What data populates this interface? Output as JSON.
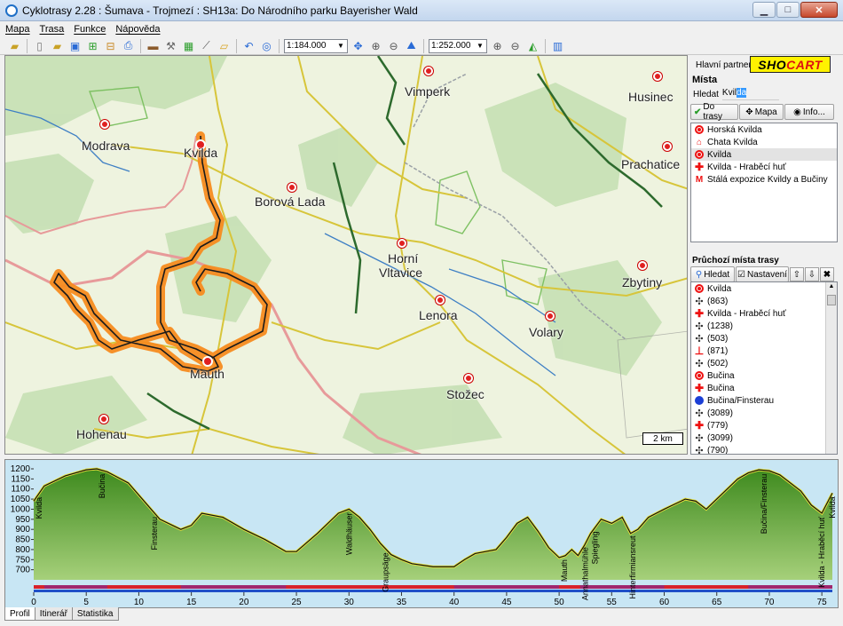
{
  "window": {
    "title": "Cyklotrasy 2.28 : Šumava - Trojmezí : SH13a: Do Národního parku Bayerisher Wald"
  },
  "menu": [
    "Mapa",
    "Trasa",
    "Funkce",
    "Nápověda"
  ],
  "toolbar": {
    "scale1": "1:184.000",
    "scale2": "1:252.000"
  },
  "map": {
    "towns": [
      {
        "name": "Vimperk"
      },
      {
        "name": "Husinec"
      },
      {
        "name": "Modrava"
      },
      {
        "name": "Kvilda"
      },
      {
        "name": "Prachatice"
      },
      {
        "name": "Borová Lada"
      },
      {
        "name": "Horní"
      },
      {
        "name": "Vltavice"
      },
      {
        "name": "Lenora"
      },
      {
        "name": "Zbytiny"
      },
      {
        "name": "Volary"
      },
      {
        "name": "Mauth"
      },
      {
        "name": "Stožec"
      },
      {
        "name": "Hohenau"
      }
    ],
    "scale_label": "2 km"
  },
  "panel": {
    "partner_label": "Hlavní partner",
    "logo_text_a": "SHO",
    "logo_text_b": "CART",
    "places_title": "Místa",
    "search_label": "Hledat",
    "search_value_a": "Kvil",
    "search_value_b": "da",
    "btn_route": "Do trasy",
    "btn_map": "Mapa",
    "btn_info": "Info...",
    "places": [
      {
        "icon": "circle",
        "label": "Horská Kvilda"
      },
      {
        "icon": "house",
        "label": "Chata Kvilda"
      },
      {
        "icon": "circle",
        "label": "Kvilda"
      },
      {
        "icon": "cross",
        "label": "Kvilda - Hraběcí huť"
      },
      {
        "icon": "m",
        "label": "Stálá expozice Kvildy a Bučiny"
      }
    ],
    "trace_title": "Průchozí místa trasy",
    "trace_search": "Hledat",
    "trace_settings": "Nastavení",
    "trace": [
      {
        "icon": "circle",
        "label": "Kvilda"
      },
      {
        "icon": "star",
        "label": "(863)"
      },
      {
        "icon": "cross",
        "label": "Kvilda - Hraběcí huť"
      },
      {
        "icon": "star",
        "label": "(1238)"
      },
      {
        "icon": "star",
        "label": "(503)"
      },
      {
        "icon": "tee",
        "label": "(871)"
      },
      {
        "icon": "star",
        "label": "(502)"
      },
      {
        "icon": "circle",
        "label": "Bučina"
      },
      {
        "icon": "cross",
        "label": "Bučina"
      },
      {
        "icon": "blue",
        "label": "Bučina/Finsterau"
      },
      {
        "icon": "star",
        "label": "(3089)"
      },
      {
        "icon": "cross",
        "label": "(779)"
      },
      {
        "icon": "star",
        "label": "(3099)"
      },
      {
        "icon": "star",
        "label": "(790)"
      }
    ]
  },
  "chart_data": {
    "type": "area",
    "xlabel": "",
    "ylabel": "",
    "xlim": [
      0,
      76
    ],
    "ylim": [
      650,
      1200
    ],
    "x_ticks": [
      0,
      5,
      10,
      15,
      20,
      25,
      30,
      35,
      40,
      45,
      50,
      55,
      60,
      65,
      70,
      75
    ],
    "y_ticks": [
      700,
      750,
      800,
      850,
      900,
      950,
      1000,
      1050,
      1100,
      1150,
      1200
    ],
    "x": [
      0,
      1,
      3,
      5,
      6,
      7,
      9,
      11,
      12,
      14,
      15,
      16,
      18,
      20,
      22,
      24,
      25,
      27,
      29,
      30,
      31,
      32,
      33,
      34,
      35,
      36,
      38,
      40,
      41,
      42,
      44,
      45,
      46,
      47,
      48,
      49,
      50,
      50.6,
      51.2,
      51.8,
      52.4,
      53,
      54,
      55,
      56,
      56.8,
      57.5,
      58.5,
      60,
      62,
      63,
      64,
      65,
      67,
      68,
      69,
      70,
      71,
      73,
      74,
      75,
      76
    ],
    "values": [
      1040,
      1115,
      1165,
      1195,
      1200,
      1185,
      1130,
      1010,
      950,
      900,
      920,
      980,
      960,
      900,
      850,
      790,
      790,
      880,
      980,
      1000,
      960,
      900,
      830,
      775,
      750,
      730,
      715,
      715,
      750,
      780,
      800,
      860,
      930,
      960,
      890,
      810,
      760,
      770,
      800,
      770,
      820,
      880,
      950,
      930,
      960,
      880,
      900,
      960,
      1000,
      1050,
      1040,
      1000,
      1050,
      1150,
      1180,
      1195,
      1190,
      1170,
      1090,
      1020,
      980,
      1080
    ],
    "annotations": [
      {
        "x": 0.5,
        "label": "Kvilda"
      },
      {
        "x": 6.5,
        "label": "Bučina"
      },
      {
        "x": 11.5,
        "label": "Finsterau"
      },
      {
        "x": 30,
        "label": "Waldhäuser"
      },
      {
        "x": 33.5,
        "label": "Graupsäge"
      },
      {
        "x": 50.5,
        "label": "Mauth"
      },
      {
        "x": 52.5,
        "label": "Annathalmühle"
      },
      {
        "x": 53.4,
        "label": "Spiegling"
      },
      {
        "x": 57,
        "label": "Hinterfirmiansreut"
      },
      {
        "x": 69.5,
        "label": "Bučina/Finsterau"
      },
      {
        "x": 75,
        "label": "Kvilda - Hraběcí huť"
      },
      {
        "x": 76,
        "label": "Kvilda"
      }
    ]
  },
  "tabs": [
    "Profil",
    "Itinerář",
    "Statistika"
  ]
}
